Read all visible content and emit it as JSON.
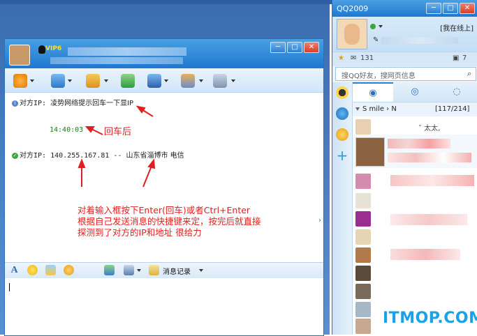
{
  "chat_window": {
    "vip_label": "VIP6",
    "window_buttons": [
      "─",
      "□",
      "✕"
    ],
    "messages": {
      "line1_prefix": "对方IP:",
      "line1_text": "凌势网络提示回车一下显IP",
      "timestamp": "14:40:03",
      "line2_prefix": "对方IP:",
      "line2_ip": "140.255.167.81",
      "line2_sep": "--",
      "line2_location": "山东省淄博市 电信"
    },
    "annotations": {
      "enter_note": "回车后",
      "instruction_1": "对着输入框按下Enter(回车)或者Ctrl+Enter",
      "instruction_2": "根据自己发送消息的快捷键来定，按完后就直接",
      "instruction_3": "探测到了对方的IP和地址 很给力"
    },
    "input_toolbar": {
      "font_button": "A",
      "message_record": "消息记录"
    }
  },
  "qq_panel": {
    "title": "QQ2009",
    "window_buttons": [
      "─",
      "□",
      "✕"
    ],
    "status": "[我在线上]",
    "mail_count": "131",
    "notify_count": "7",
    "search_placeholder": "搜QQ好友，搜网页信息",
    "group_name": "S mile › N",
    "group_count": "[117/214]",
    "friend_snippet": "ˇ  太太,"
  },
  "watermark": "ITMOP.COM",
  "colors": {
    "title_blue": "#1f78cf",
    "annotation_red": "#e02020",
    "timestamp_green": "#1f7a1f",
    "watermark_blue": "#17a3e8"
  }
}
